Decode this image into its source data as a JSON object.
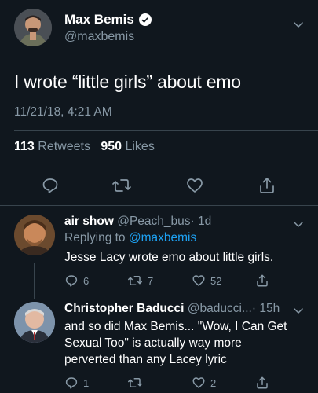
{
  "main_tweet": {
    "name": "Max Bemis",
    "handle": "@maxbemis",
    "text": "I wrote “little girls” about emo",
    "date": "11/21/18, 4:21 AM",
    "retweets_count": "113",
    "retweets_label": "Retweets",
    "likes_count": "950",
    "likes_label": "Likes"
  },
  "replies": [
    {
      "name": "air show",
      "handle": "@Peach_bus",
      "time": "· 1d",
      "replying_prefix": "Replying to",
      "replying_to": "@maxbemis",
      "text": "Jesse Lacy wrote emo about little girls.",
      "reply_count": "6",
      "retweet_count": "7",
      "like_count": "52"
    },
    {
      "name": "Christopher Baducci",
      "handle": "@baducci...",
      "time": "· 15h",
      "text_line1": "and so did Max Bemis... \"Wow, I Can Get",
      "text_line2": "Sexual Too\" is actually way more",
      "text_line3": "perverted than any Lacey lyric",
      "reply_count": "1",
      "like_count": "2"
    }
  ],
  "colors": {
    "background": "#10171e",
    "muted": "#8899a6",
    "link": "#1da1f2",
    "divider": "#38444d"
  },
  "icons": [
    "verified-icon",
    "chevron-down-icon",
    "reply-icon",
    "retweet-icon",
    "like-icon",
    "share-icon"
  ]
}
